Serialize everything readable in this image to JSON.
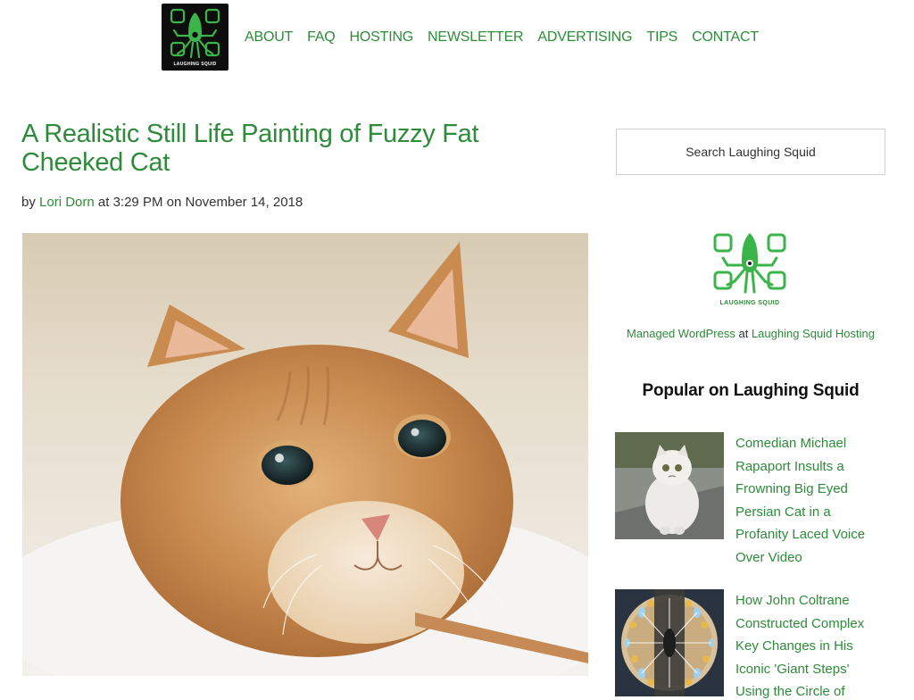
{
  "site": {
    "logo_text": "LAUGHING SQUID",
    "brand_color": "#2e8b3a"
  },
  "nav": {
    "items": [
      "ABOUT",
      "FAQ",
      "HOSTING",
      "NEWSLETTER",
      "ADVERTISING",
      "TIPS",
      "CONTACT"
    ]
  },
  "article": {
    "title": "A Realistic Still Life Painting of Fuzzy Fat Cheeked Cat",
    "byline": {
      "prefix": "by ",
      "author": "Lori Dorn",
      "middle": " at ",
      "time": "3:29 PM",
      "on": " on ",
      "date": "November 14, 2018"
    },
    "hero_image": "fluffy-orange-cat-painting"
  },
  "sidebar": {
    "search_placeholder": "Search Laughing Squid",
    "logo_text": "LAUGHING SQUID",
    "hosting_link_a": "Managed WordPress",
    "hosting_middle": " at ",
    "hosting_link_b": "Laughing Squid Hosting",
    "popular_title": "Popular on Laughing Squid",
    "popular": [
      {
        "title_lines": [
          "Comedian Michael",
          "Rapaport Insults a",
          "Frowning Big Eyed",
          "Persian Cat in a",
          "Profanity Laced Voice",
          "Over Video"
        ],
        "thumb": "white-persian-cat"
      },
      {
        "title_lines": [
          "How John Coltrane",
          "Constructed Complex",
          "Key Changes in His",
          "Iconic 'Giant Steps'",
          "Using the Circle of"
        ],
        "thumb": "coltrane-circle-diagram"
      }
    ]
  }
}
